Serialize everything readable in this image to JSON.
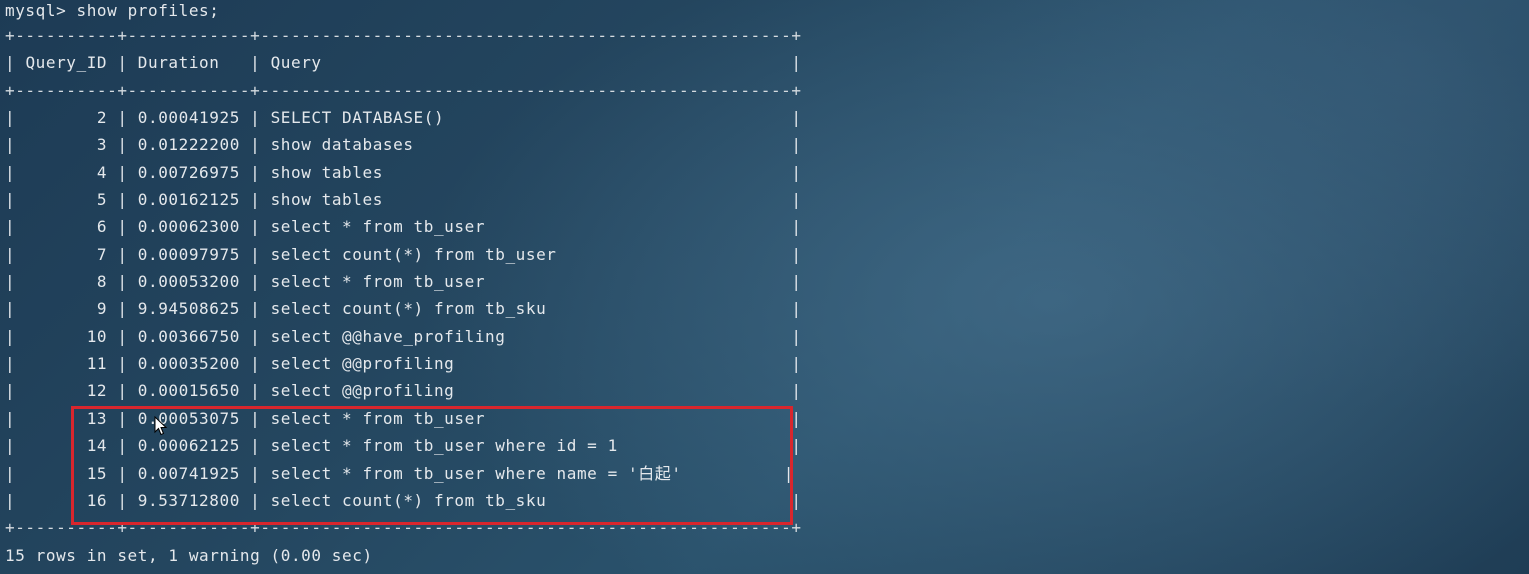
{
  "terminal": {
    "prompt": "mysql>",
    "command": "show profiles;",
    "separator": "+----------+------------+----------------------------------------------------+",
    "headers": [
      "Query_ID",
      "Duration",
      "Query"
    ],
    "rows": [
      {
        "id": "2",
        "duration": "0.00041925",
        "query": "SELECT DATABASE()"
      },
      {
        "id": "3",
        "duration": "0.01222200",
        "query": "show databases"
      },
      {
        "id": "4",
        "duration": "0.00726975",
        "query": "show tables"
      },
      {
        "id": "5",
        "duration": "0.00162125",
        "query": "show tables"
      },
      {
        "id": "6",
        "duration": "0.00062300",
        "query": "select * from tb_user"
      },
      {
        "id": "7",
        "duration": "0.00097975",
        "query": "select count(*) from tb_user"
      },
      {
        "id": "8",
        "duration": "0.00053200",
        "query": "select * from tb_user"
      },
      {
        "id": "9",
        "duration": "9.94508625",
        "query": "select count(*) from tb_sku"
      },
      {
        "id": "10",
        "duration": "0.00366750",
        "query": "select @@have_profiling"
      },
      {
        "id": "11",
        "duration": "0.00035200",
        "query": "select @@profiling"
      },
      {
        "id": "12",
        "duration": "0.00015650",
        "query": "select @@profiling"
      },
      {
        "id": "13",
        "duration": "0.00053075",
        "query": "select * from tb_user"
      },
      {
        "id": "14",
        "duration": "0.00062125",
        "query": "select * from tb_user where id = 1"
      },
      {
        "id": "15",
        "duration": "0.00741925",
        "query": "select * from tb_user where name = '白起'"
      },
      {
        "id": "16",
        "duration": "9.53712800",
        "query": "select count(*) from tb_sku"
      }
    ],
    "footer": "15 rows in set, 1 warning (0.00 sec)",
    "highlight_color": "#d9262d"
  }
}
